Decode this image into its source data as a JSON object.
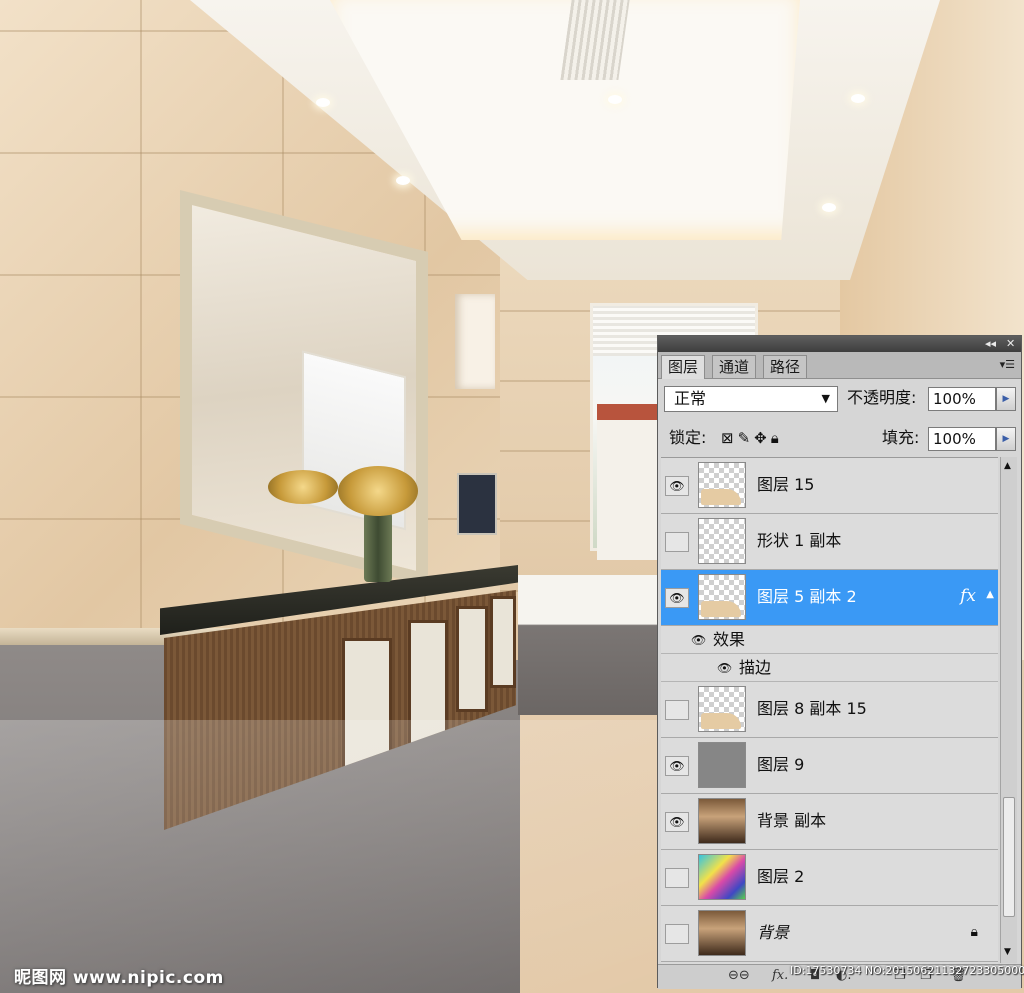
{
  "panel": {
    "titlebar": {
      "collapse_icon": "double-arrow-icon",
      "close_icon": "close-icon"
    },
    "tabs": [
      {
        "label": "图层",
        "active": true
      },
      {
        "label": "通道",
        "active": false
      },
      {
        "label": "路径",
        "active": false
      }
    ],
    "blend_mode": "正常",
    "opacity_label": "不透明度:",
    "opacity_value": "100%",
    "lock_label": "锁定:",
    "fill_label": "填充:",
    "fill_value": "100%",
    "layers": [
      {
        "name": "图层 15",
        "visible": true,
        "thumb": "transparent-sand"
      },
      {
        "name": "形状 1 副本",
        "visible": false,
        "thumb": "transparent"
      },
      {
        "name": "图层 5 副本 2",
        "visible": true,
        "thumb": "transparent-sand",
        "selected": true,
        "fx": "fx"
      },
      {
        "name": "图层 8 副本 15",
        "visible": false,
        "thumb": "transparent-sand"
      },
      {
        "name": "图层 9",
        "visible": true,
        "thumb": "gray"
      },
      {
        "name": "背景 副本",
        "visible": true,
        "thumb": "photo"
      },
      {
        "name": "图层 2",
        "visible": false,
        "thumb": "colors"
      },
      {
        "name": "背景",
        "visible": false,
        "thumb": "photo",
        "locked": true
      }
    ],
    "effects": {
      "label": "效果",
      "stroke": "描边"
    }
  },
  "watermark": "昵图网 www.nipic.com",
  "image_id": "ID:17530734 NO:20150621132723305000"
}
